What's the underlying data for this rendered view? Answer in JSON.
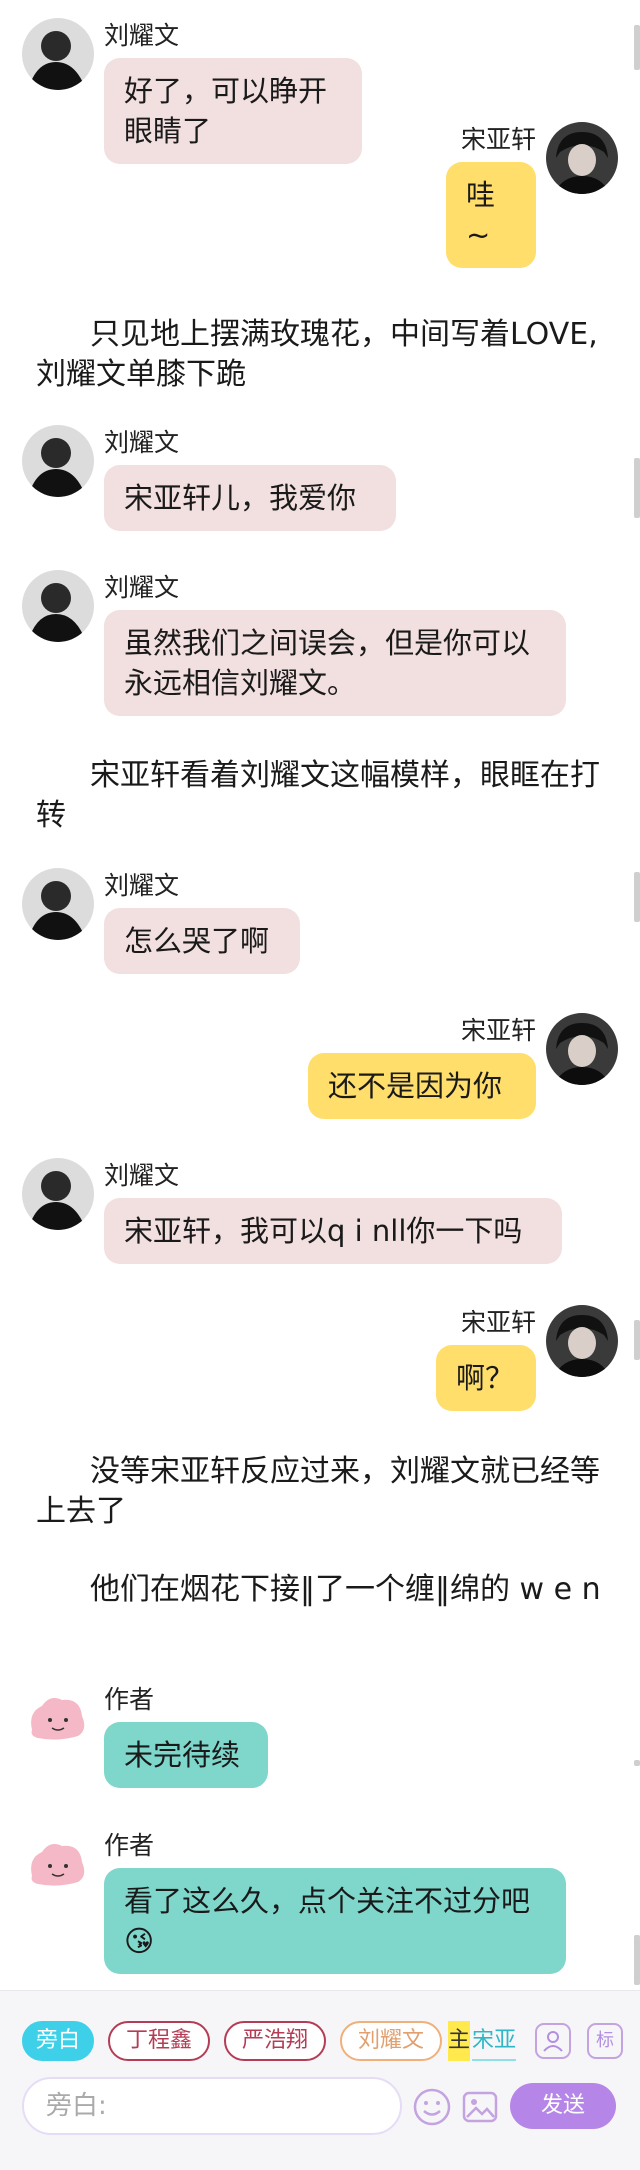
{
  "feed": [
    {
      "type": "left",
      "name": "刘耀文",
      "text": "好了，可以睁开眼睛了",
      "color": "pink",
      "avatar": "boy-avatar"
    },
    {
      "type": "right",
      "name": "宋亚轩",
      "text": "哇~",
      "color": "yellow",
      "avatar": "boy-avatar"
    },
    {
      "type": "narration",
      "text": "只见地上摆满玫瑰花，中间写着LOVE,刘耀文单膝下跪"
    },
    {
      "type": "left",
      "name": "刘耀文",
      "text": "宋亚轩儿，我爱你",
      "color": "pink",
      "avatar": "boy-avatar"
    },
    {
      "type": "left",
      "name": "刘耀文",
      "text": "虽然我们之间误会，但是你可以永远相信刘耀文。",
      "color": "pink",
      "avatar": "boy-avatar"
    },
    {
      "type": "narration",
      "text": "宋亚轩看着刘耀文这幅模样，眼眶在打转"
    },
    {
      "type": "left",
      "name": "刘耀文",
      "text": "怎么哭了啊",
      "color": "pink",
      "avatar": "boy-avatar"
    },
    {
      "type": "right",
      "name": "宋亚轩",
      "text": "还不是因为你",
      "color": "yellow",
      "avatar": "boy-avatar"
    },
    {
      "type": "left",
      "name": "刘耀文",
      "text": "宋亚轩，我可以q i nll你一下吗",
      "color": "pink",
      "avatar": "boy-avatar"
    },
    {
      "type": "right",
      "name": "宋亚轩",
      "text": "啊？",
      "color": "yellow",
      "avatar": "boy-avatar"
    },
    {
      "type": "narration",
      "text": "没等宋亚轩反应过来，刘耀文就已经等上去了"
    },
    {
      "type": "narration",
      "text": "他们在烟花下接‖了一个缠‖绵的 w e n"
    },
    {
      "type": "left",
      "name": "作者",
      "text": "未完待续",
      "color": "teal",
      "avatar": "ditto-avatar"
    },
    {
      "type": "left",
      "name": "作者",
      "text": "看了这么久，点个关注不过分吧",
      "emoji": "😘",
      "color": "teal",
      "avatar": "ditto-avatar"
    }
  ],
  "composer": {
    "role_chips": [
      "旁白",
      "丁程鑫",
      "严浩翔",
      "刘耀文"
    ],
    "main_marker": "主",
    "main_role": "宋亚",
    "profile_icon": "person-icon",
    "tag_icon_label": "标",
    "input_placeholder": "旁白:",
    "emoji_icon": "smiley-icon",
    "image_icon": "image-icon",
    "send_label": "发送"
  },
  "colors": {
    "pink_bubble": "#f2dfdf",
    "yellow_bubble": "#ffde6b",
    "teal_bubble": "#7fd7cc",
    "send_button": "#b685e8",
    "narration_chip": "#3fd0e9"
  }
}
